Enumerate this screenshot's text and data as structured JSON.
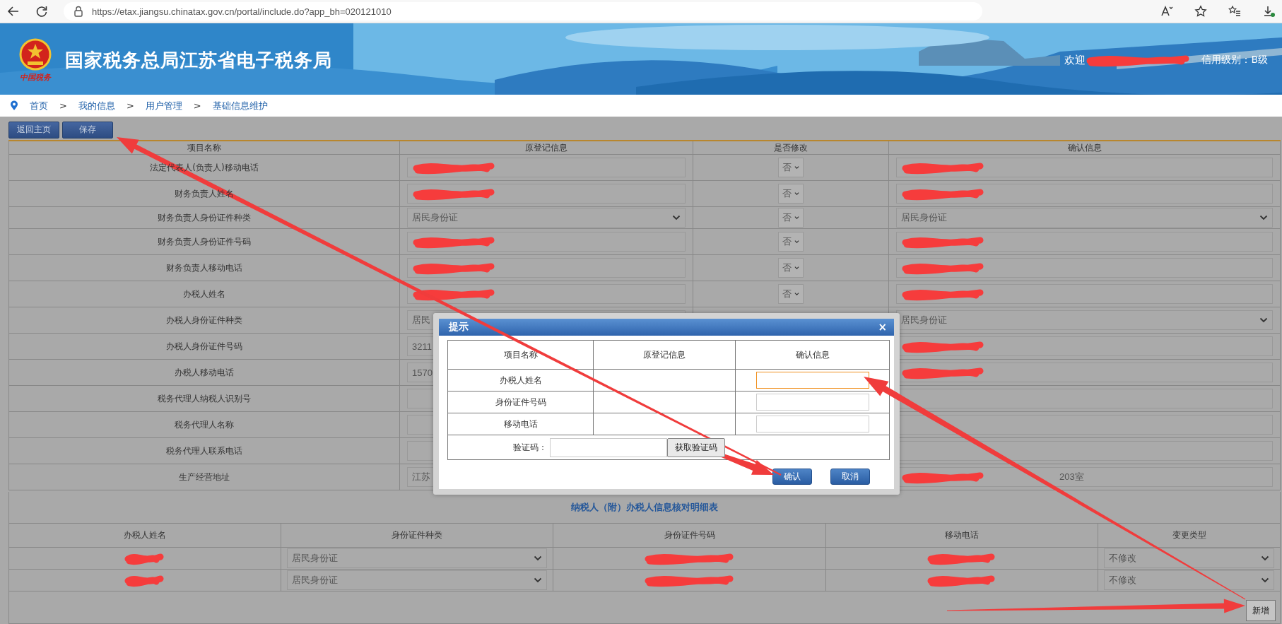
{
  "browser": {
    "url": "https://etax.jiangsu.chinatax.gov.cn/portal/include.do?app_bh=020121010"
  },
  "banner": {
    "logo_caption": "中国税务",
    "title": "国家税务总局江苏省电子税务局",
    "welcome": "欢迎",
    "welcome_redacted": true,
    "credit": "信用级别：B级"
  },
  "breadcrumb": [
    {
      "kind": "link",
      "text": "首页"
    },
    {
      "kind": "separator",
      "text": ">"
    },
    {
      "kind": "link",
      "text": "我的信息"
    },
    {
      "kind": "separator",
      "text": ">"
    },
    {
      "kind": "link",
      "text": "用户管理"
    },
    {
      "kind": "separator",
      "text": ">"
    },
    {
      "kind": "link",
      "text": "基础信息维护"
    }
  ],
  "toolbar": [
    "返回主页",
    "保存"
  ],
  "form": {
    "columns": [
      "项目名称",
      "原登记信息",
      "是否修改",
      "确认信息"
    ],
    "rows": [
      {
        "label": "法定代表人(负责人)移动电话",
        "original": {
          "kind": "text",
          "redacted": true
        },
        "modify": "否",
        "confirm": {
          "kind": "text",
          "redacted": true
        }
      },
      {
        "label": "财务负责人姓名",
        "original": {
          "kind": "text",
          "redacted": true
        },
        "modify": "否",
        "confirm": {
          "kind": "text",
          "redacted": true
        }
      },
      {
        "label": "财务负责人身份证件种类",
        "original": {
          "kind": "select",
          "value": "居民身份证"
        },
        "modify": "否",
        "confirm": {
          "kind": "select",
          "value": "居民身份证"
        }
      },
      {
        "label": "财务负责人身份证件号码",
        "original": {
          "kind": "text",
          "redacted": true
        },
        "modify": "否",
        "confirm": {
          "kind": "text",
          "redacted": true
        }
      },
      {
        "label": "财务负责人移动电话",
        "original": {
          "kind": "text",
          "redacted": true
        },
        "modify": "否",
        "confirm": {
          "kind": "text",
          "redacted": true
        }
      },
      {
        "label": "办税人姓名",
        "original": {
          "kind": "text",
          "redacted": true
        },
        "modify": "否",
        "confirm": {
          "kind": "text",
          "redacted": true
        }
      },
      {
        "label": "办税人身份证件种类",
        "original": {
          "kind": "text",
          "value": "居民"
        },
        "confirm": {
          "kind": "select",
          "value": "居民身份证"
        }
      },
      {
        "label": "办税人身份证件号码",
        "original": {
          "kind": "text",
          "value": "3211"
        },
        "confirm": {
          "kind": "text",
          "redacted": true
        }
      },
      {
        "label": "办税人移动电话",
        "original": {
          "kind": "text",
          "value": "1570"
        },
        "confirm": {
          "kind": "text",
          "redacted": true
        }
      },
      {
        "label": "税务代理人纳税人识别号",
        "original": {
          "kind": "text"
        },
        "confirm": {
          "kind": "text"
        }
      },
      {
        "label": "税务代理人名称",
        "original": {
          "kind": "text"
        },
        "confirm": {
          "kind": "text"
        }
      },
      {
        "label": "税务代理人联系电话",
        "original": {
          "kind": "text"
        },
        "confirm": {
          "kind": "text"
        }
      },
      {
        "label": "生产经营地址",
        "original": {
          "kind": "text",
          "value": "江苏"
        },
        "confirm": {
          "kind": "text",
          "value": "203室",
          "redacted": true
        }
      }
    ]
  },
  "detail": {
    "title": "纳税人（附）办税人信息核对明细表",
    "columns": [
      "办税人姓名",
      "身份证件种类",
      "身份证件号码",
      "移动电话",
      "变更类型"
    ],
    "rows": [
      {
        "name_redacted": true,
        "id_type": "居民身份证",
        "id_number_redacted": true,
        "phone_redacted": true,
        "change_type": "不修改"
      },
      {
        "name_redacted": true,
        "id_type": "居民身份证",
        "id_number_redacted": true,
        "phone_redacted": true,
        "change_type": "不修改"
      }
    ],
    "add_button": "新增"
  },
  "dialog": {
    "title": "提示",
    "close": "×",
    "columns": [
      "项目名称",
      "原登记信息",
      "确认信息"
    ],
    "rows": [
      {
        "label": "办税人姓名",
        "focused": true
      },
      {
        "label": "身份证件号码",
        "focused": false
      },
      {
        "label": "移动电话",
        "focused": false
      }
    ],
    "captcha_label": "验证码：",
    "captcha_button": "获取验证码",
    "buttons": [
      "确认",
      "取消"
    ]
  }
}
